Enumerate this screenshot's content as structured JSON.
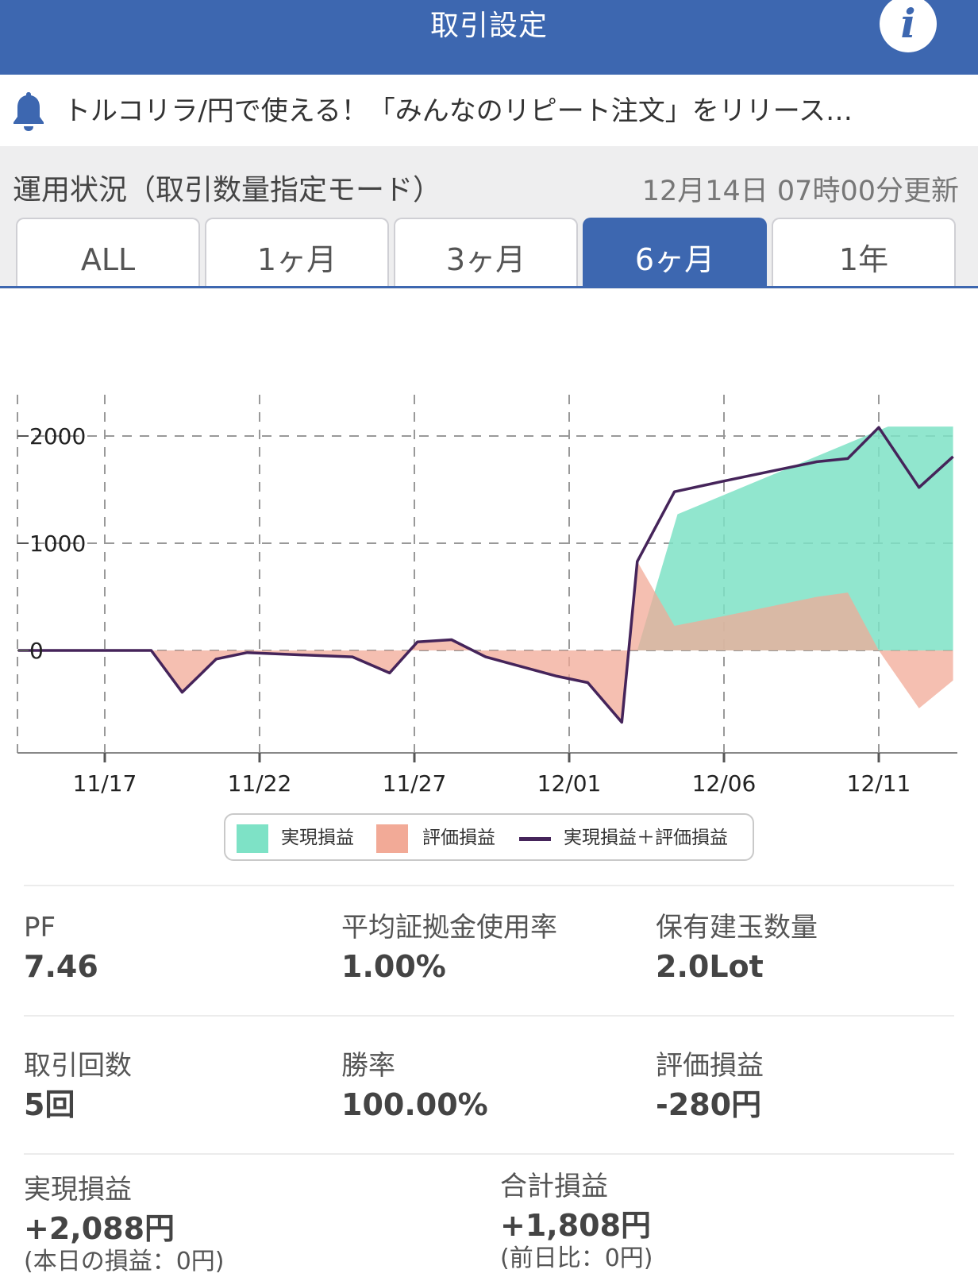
{
  "header": {
    "title": "取引設定",
    "info_label": "i"
  },
  "notice": {
    "icon": "bell-icon",
    "text": "トルコリラ/円で使える！「みんなのリピート注文」をリリース…"
  },
  "status": {
    "title": "運用状況（取引数量指定モード）",
    "updated": "12月14日 07時00分更新"
  },
  "tabs": [
    {
      "label": "ALL",
      "active": false
    },
    {
      "label": "1ヶ月",
      "active": false
    },
    {
      "label": "3ヶ月",
      "active": false
    },
    {
      "label": "6ヶ月",
      "active": true
    },
    {
      "label": "1年",
      "active": false
    }
  ],
  "colors": {
    "accent": "#3d67b0",
    "realized": "#7ee2c6",
    "unrealized": "#f2aa97",
    "total_line": "#45245a"
  },
  "chart_data": {
    "type": "area",
    "x_tick_labels": [
      "11/17",
      "11/22",
      "11/27",
      "12/01",
      "12/06",
      "12/11"
    ],
    "x_ticks_day": [
      0,
      5,
      10,
      15,
      20,
      25
    ],
    "y_ticks": [
      0,
      1000,
      2000
    ],
    "ylim": [
      -950,
      2350
    ],
    "xlim": [
      -2.8,
      27.4
    ],
    "grid": true,
    "legend_position": "bottom",
    "series": [
      {
        "name": "実現損益",
        "kind": "area",
        "x": [
          -2.8,
          17.2,
          18.5,
          25.3,
          27.4
        ],
        "values": [
          0,
          0,
          1270,
          2088,
          2088
        ]
      },
      {
        "name": "評価損益",
        "kind": "area",
        "x": [
          -2.8,
          1.5,
          2.5,
          3.6,
          4.6,
          6.2,
          8.0,
          9.2,
          10.1,
          11.2,
          12.3,
          14.6,
          15.6,
          16.7,
          17.2,
          18.4,
          20.0,
          23.0,
          24.0,
          25.0,
          26.3,
          27.4
        ],
        "values": [
          0,
          0,
          -390,
          -80,
          -20,
          -40,
          -60,
          -210,
          80,
          100,
          -60,
          -240,
          -300,
          -670,
          830,
          230,
          320,
          500,
          540,
          0,
          -540,
          -280
        ]
      },
      {
        "name": "実現損益＋評価損益",
        "kind": "line",
        "x": [
          -2.8,
          1.5,
          2.5,
          3.6,
          4.6,
          6.2,
          8.0,
          9.2,
          10.1,
          11.2,
          12.3,
          14.6,
          15.6,
          16.7,
          17.2,
          18.4,
          20.0,
          23.0,
          24.0,
          25.0,
          26.3,
          27.4
        ],
        "values": [
          0,
          0,
          -390,
          -80,
          -20,
          -40,
          -60,
          -210,
          80,
          100,
          -60,
          -240,
          -300,
          -670,
          830,
          1480,
          1580,
          1760,
          1790,
          2080,
          1520,
          1808
        ]
      }
    ]
  },
  "legend": [
    {
      "label": "実現損益",
      "swatch": "area",
      "color": "#7ee2c6"
    },
    {
      "label": "評価損益",
      "swatch": "area",
      "color": "#f2aa97"
    },
    {
      "label": "実現損益＋評価損益",
      "swatch": "line",
      "color": "#45245a"
    }
  ],
  "stats": {
    "pf": {
      "label": "PF",
      "value": "7.46"
    },
    "avg_margin": {
      "label": "平均証拠金使用率",
      "value": "1.00%"
    },
    "positions": {
      "label": "保有建玉数量",
      "value": "2.0Lot"
    },
    "trades": {
      "label": "取引回数",
      "value": "5回"
    },
    "win_rate": {
      "label": "勝率",
      "value": "100.00%"
    },
    "unrealized": {
      "label": "評価損益",
      "value": "-280円"
    },
    "realized": {
      "label": "実現損益",
      "value": "+2,088円",
      "sub": "(本日の損益：0円)"
    },
    "total": {
      "label": "合計損益",
      "value": "+1,808円",
      "sub": "(前日比：0円)"
    }
  }
}
